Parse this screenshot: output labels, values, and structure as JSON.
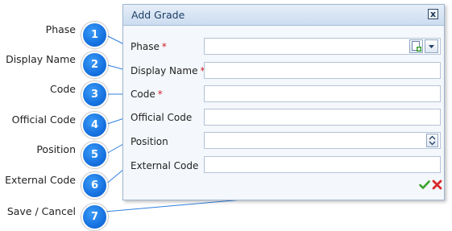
{
  "callouts": [
    {
      "number": "1",
      "label": "Phase"
    },
    {
      "number": "2",
      "label": "Display Name"
    },
    {
      "number": "3",
      "label": "Code"
    },
    {
      "number": "4",
      "label": "Official Code"
    },
    {
      "number": "5",
      "label": "Position"
    },
    {
      "number": "6",
      "label": "External Code"
    },
    {
      "number": "7",
      "label": "Save / Cancel"
    }
  ],
  "dialog": {
    "title": "Add Grade",
    "close_glyph": "x",
    "required_marker": "*",
    "fields": [
      {
        "label": "Phase",
        "required": true,
        "value": ""
      },
      {
        "label": "Display Name",
        "required": true,
        "value": ""
      },
      {
        "label": "Code",
        "required": true,
        "value": ""
      },
      {
        "label": "Official Code",
        "required": false,
        "value": ""
      },
      {
        "label": "Position",
        "required": false,
        "value": ""
      },
      {
        "label": "External Code",
        "required": false,
        "value": ""
      }
    ],
    "icons": {
      "add": "add-new-icon",
      "dropdown": "chevron-down-icon",
      "spin_up": "spin-up-icon",
      "spin_down": "spin-down-icon",
      "save": "checkmark-icon",
      "cancel": "red-x-icon"
    },
    "colors": {
      "required": "#d2202a",
      "save": "#3aa12e",
      "cancel": "#d8282a",
      "badge": "#1672e0"
    }
  }
}
